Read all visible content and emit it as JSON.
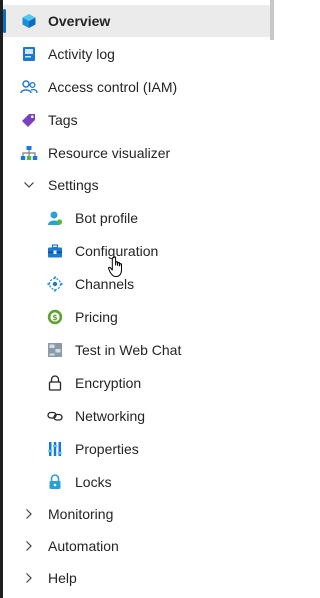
{
  "nav": {
    "overview": "Overview",
    "activity_log": "Activity log",
    "access_control": "Access control (IAM)",
    "tags": "Tags",
    "resource_visualizer": "Resource visualizer",
    "settings": {
      "label": "Settings",
      "expanded": true,
      "children": {
        "bot_profile": "Bot profile",
        "configuration": "Configuration",
        "channels": "Channels",
        "pricing": "Pricing",
        "test_in_web_chat": "Test in Web Chat",
        "encryption": "Encryption",
        "networking": "Networking",
        "properties": "Properties",
        "locks": "Locks"
      }
    },
    "monitoring": "Monitoring",
    "automation": "Automation",
    "help": "Help"
  },
  "selected_item": "Overview",
  "colors": {
    "accent": "#0f6cbd",
    "selected_bg": "#ebebeb",
    "text": "#242424"
  }
}
